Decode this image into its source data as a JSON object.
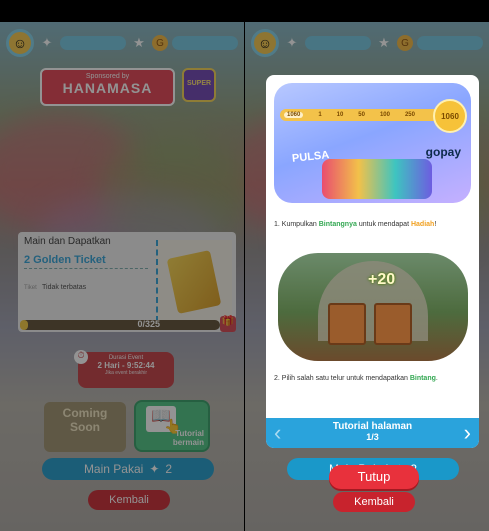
{
  "left": {
    "sponsor": {
      "by": "Sponsored by",
      "brand": "HANAMASA"
    },
    "super_icon": "SUPER",
    "card": {
      "title": "Main dan Dapatkan",
      "subtitle": "2 Golden Ticket",
      "note_label": "Tiket",
      "note": "Tidak terbatas"
    },
    "progress": {
      "text": "0/325",
      "fraction": 0.0
    },
    "duration": {
      "label": "Durasi Event",
      "time": "2 Hari - 9:52:44",
      "hint": "Jika event berakhir"
    },
    "coming": {
      "line1": "Coming",
      "line2": "Soon"
    },
    "tutorial": {
      "label_top": "Tutorial",
      "label_bottom": "bermain"
    },
    "main_pakai": {
      "label": "Main Pakai",
      "count": "2"
    },
    "kembali": "Kembali"
  },
  "modal": {
    "scorebar": {
      "start": "1060",
      "marks": [
        "1",
        "10",
        "50",
        "100",
        "250"
      ],
      "end": "1060"
    },
    "pulsa": "PULSA",
    "gopay": "gopay",
    "step1": {
      "prefix": "1. Kumpulkan ",
      "star": "Bintangnya",
      "mid": " untuk mendapat ",
      "prize": "Hadiah",
      "suffix": "!"
    },
    "plus": "+20",
    "step2": {
      "prefix": "2. Pilih salah satu telur untuk mendapatkan ",
      "star": "Bintang",
      "suffix": "."
    },
    "pager": {
      "title": "Tutorial halaman",
      "page": "1/3",
      "prev": "‹",
      "next": "›"
    }
  },
  "right": {
    "tutup": "Tutup",
    "main_pakai": {
      "label": "Main Pakai",
      "count": "2"
    },
    "kembali": "Kembali"
  },
  "icons": {
    "avatar": "face-icon",
    "gold": "star-coin-icon"
  },
  "colors": {
    "accent_blue": "#2aa3dc",
    "accent_red": "#e8313c",
    "accent_green": "#48c17f"
  }
}
